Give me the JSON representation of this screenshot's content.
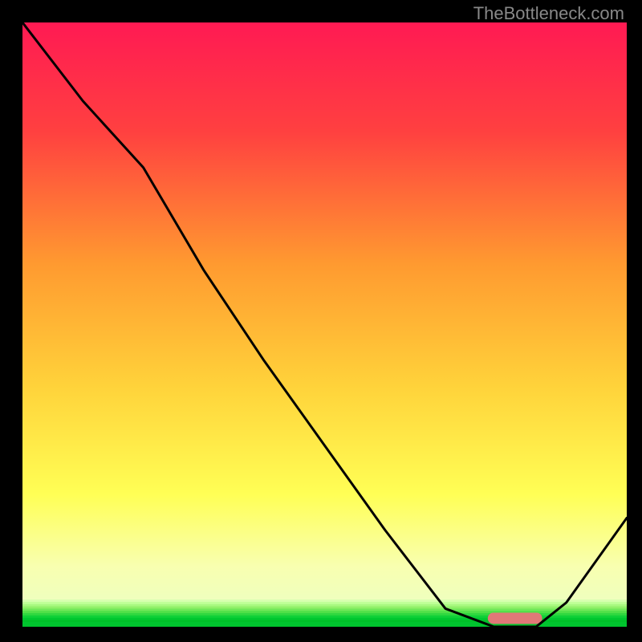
{
  "watermark": "TheBottleneck.com",
  "chart_data": {
    "type": "line",
    "title": "",
    "xlabel": "",
    "ylabel": "",
    "x": [
      0.0,
      0.1,
      0.2,
      0.3,
      0.4,
      0.5,
      0.6,
      0.7,
      0.78,
      0.85,
      0.9,
      1.0
    ],
    "values": [
      1.0,
      0.87,
      0.76,
      0.59,
      0.44,
      0.3,
      0.16,
      0.03,
      0.0,
      0.0,
      0.04,
      0.18
    ],
    "xlim": [
      0,
      1
    ],
    "ylim": [
      0,
      1
    ],
    "background": "vertical-gradient",
    "gradient_colors": [
      "#ff1a53",
      "#ff6a3d",
      "#ffd23f",
      "#ffff6a",
      "#f6ffb0",
      "#00e060"
    ],
    "bottom_bands": true,
    "marker": {
      "x_start": 0.77,
      "x_end": 0.86,
      "y": 0.01,
      "color": "#e07878"
    }
  }
}
